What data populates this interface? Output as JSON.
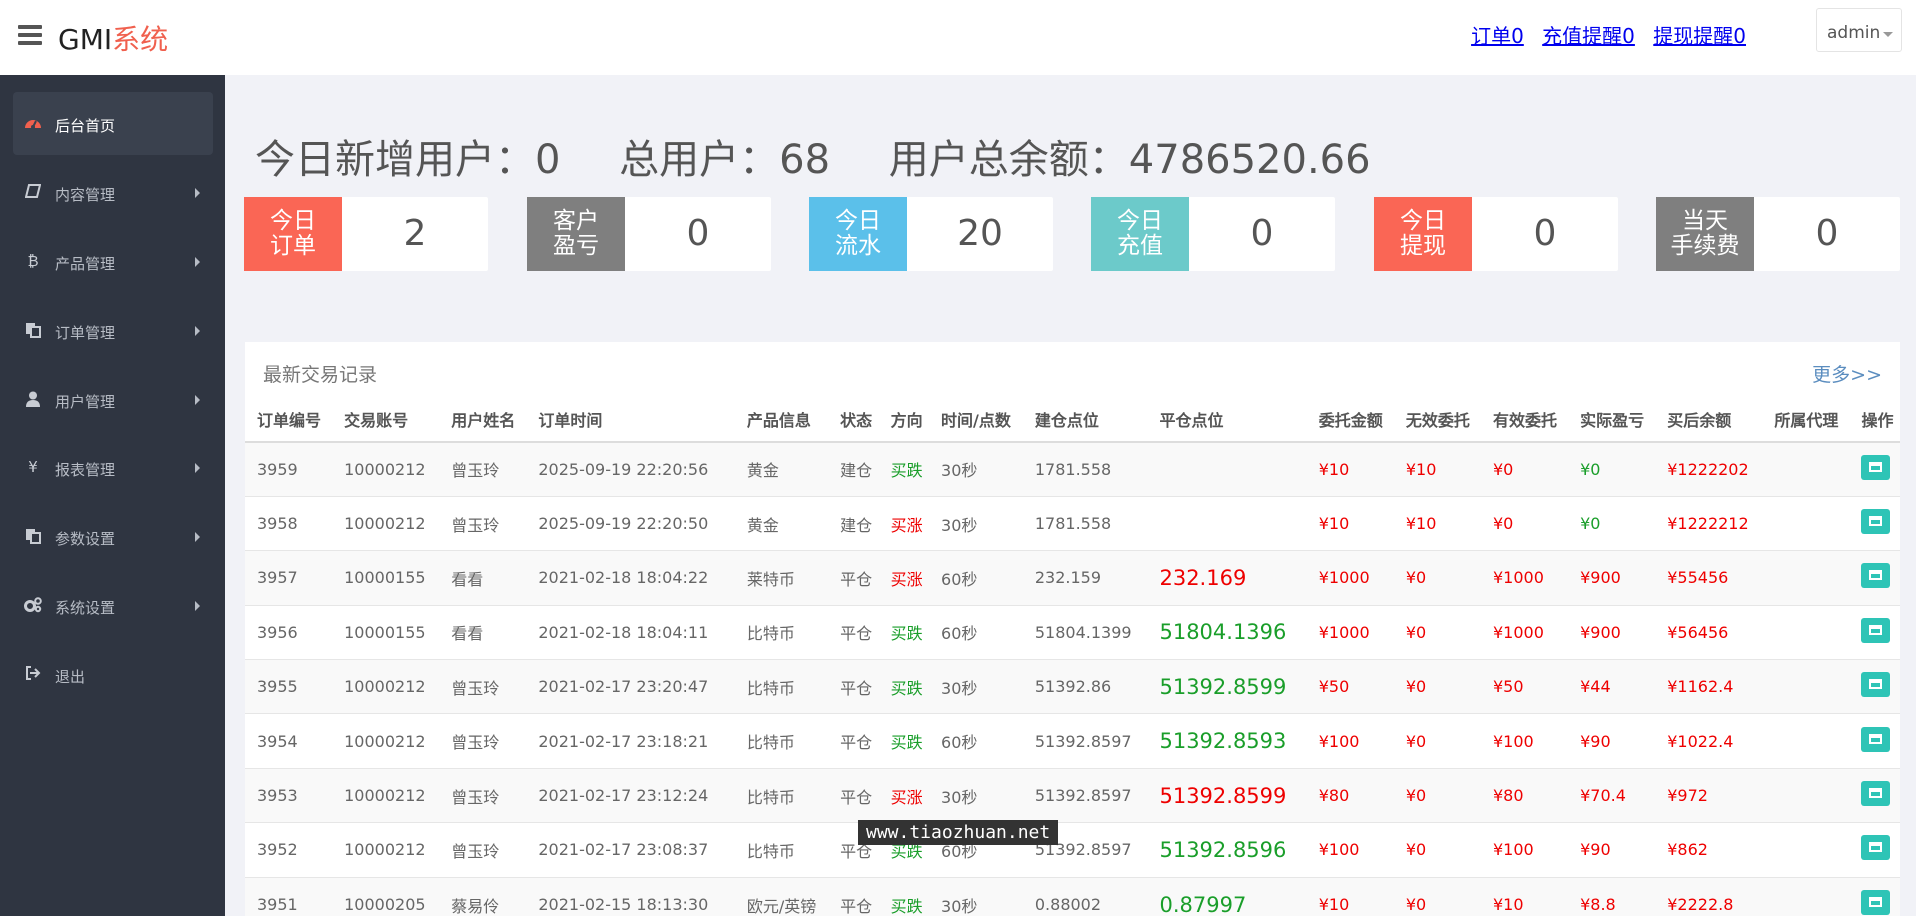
{
  "header": {
    "brand_main": "GMI",
    "brand_accent": "系统",
    "links": [
      "订单0",
      "充值提醒0",
      "提现提醒0"
    ],
    "user": "admin"
  },
  "sidebar": {
    "items": [
      {
        "label": "后台首页",
        "icon": "dashboard-icon",
        "active": true
      },
      {
        "label": "内容管理",
        "icon": "book-icon"
      },
      {
        "label": "产品管理",
        "icon": "bitcoin-icon"
      },
      {
        "label": "订单管理",
        "icon": "copy-icon"
      },
      {
        "label": "用户管理",
        "icon": "user-icon"
      },
      {
        "label": "报表管理",
        "icon": "yen-icon"
      },
      {
        "label": "参数设置",
        "icon": "copy-icon"
      },
      {
        "label": "系统设置",
        "icon": "gears-icon"
      },
      {
        "label": "退出",
        "icon": "sign-out-icon"
      }
    ]
  },
  "summary": {
    "new_users": "今日新增用户：0",
    "total_users": "总用户：68",
    "balance": "用户总余额：4786520.66"
  },
  "cards": [
    {
      "label": "今日订单",
      "line1": "今日",
      "line2": "订单",
      "value": "2",
      "color": "#fa6655"
    },
    {
      "label": "客户盈亏",
      "line1": "客户",
      "line2": "盈亏",
      "value": "0",
      "color": "#7f7f7f"
    },
    {
      "label": "今日流水",
      "line1": "今日",
      "line2": "流水",
      "value": "20",
      "color": "#5bc0ea"
    },
    {
      "label": "今日充值",
      "line1": "今日",
      "line2": "充值",
      "value": "0",
      "color": "#6ccaca"
    },
    {
      "label": "今日提现",
      "line1": "今日",
      "line2": "提现",
      "value": "0",
      "color": "#fa6655"
    },
    {
      "label": "当天手续费",
      "line1": "当天",
      "line2": "手续费",
      "value": "0",
      "color": "#7f7f7f"
    }
  ],
  "panel": {
    "title": "最新交易记录",
    "more": "更多>>",
    "columns": [
      "订单编号",
      "交易账号",
      "用户姓名",
      "订单时间",
      "产品信息",
      "状态",
      "方向",
      "时间/点数",
      "建仓点位",
      "平仓点位",
      "委托金额",
      "无效委托",
      "有效委托",
      "实际盈亏",
      "买后余额",
      "所属代理",
      "操作"
    ],
    "rows": [
      {
        "id": "3959",
        "account": "10000212",
        "name": "曾玉玲",
        "time": "2025-09-19 22:20:56",
        "product": "黄金",
        "status": "建仓",
        "dir": "买跌",
        "dir_color": "green",
        "period": "30秒",
        "open": "1781.558",
        "close": "",
        "close_color": "",
        "amount": "¥10",
        "invalid": "¥10",
        "valid": "¥0",
        "pnl": "¥0",
        "pnl_color": "green",
        "after": "¥1222202",
        "agent": ""
      },
      {
        "id": "3958",
        "account": "10000212",
        "name": "曾玉玲",
        "time": "2025-09-19 22:20:50",
        "product": "黄金",
        "status": "建仓",
        "dir": "买涨",
        "dir_color": "red",
        "period": "30秒",
        "open": "1781.558",
        "close": "",
        "close_color": "",
        "amount": "¥10",
        "invalid": "¥10",
        "valid": "¥0",
        "pnl": "¥0",
        "pnl_color": "green",
        "after": "¥1222212",
        "agent": ""
      },
      {
        "id": "3957",
        "account": "10000155",
        "name": "看看",
        "time": "2021-02-18 18:04:22",
        "product": "莱特币",
        "status": "平仓",
        "dir": "买涨",
        "dir_color": "red",
        "period": "60秒",
        "open": "232.159",
        "close": "232.169",
        "close_color": "red",
        "amount": "¥1000",
        "invalid": "¥0",
        "valid": "¥1000",
        "pnl": "¥900",
        "pnl_color": "red",
        "after": "¥55456",
        "agent": ""
      },
      {
        "id": "3956",
        "account": "10000155",
        "name": "看看",
        "time": "2021-02-18 18:04:11",
        "product": "比特币",
        "status": "平仓",
        "dir": "买跌",
        "dir_color": "green",
        "period": "60秒",
        "open": "51804.1399",
        "close": "51804.1396",
        "close_color": "green",
        "amount": "¥1000",
        "invalid": "¥0",
        "valid": "¥1000",
        "pnl": "¥900",
        "pnl_color": "red",
        "after": "¥56456",
        "agent": ""
      },
      {
        "id": "3955",
        "account": "10000212",
        "name": "曾玉玲",
        "time": "2021-02-17 23:20:47",
        "product": "比特币",
        "status": "平仓",
        "dir": "买跌",
        "dir_color": "green",
        "period": "30秒",
        "open": "51392.86",
        "close": "51392.8599",
        "close_color": "green",
        "amount": "¥50",
        "invalid": "¥0",
        "valid": "¥50",
        "pnl": "¥44",
        "pnl_color": "red",
        "after": "¥1162.4",
        "agent": ""
      },
      {
        "id": "3954",
        "account": "10000212",
        "name": "曾玉玲",
        "time": "2021-02-17 23:18:21",
        "product": "比特币",
        "status": "平仓",
        "dir": "买跌",
        "dir_color": "green",
        "period": "60秒",
        "open": "51392.8597",
        "close": "51392.8593",
        "close_color": "green",
        "amount": "¥100",
        "invalid": "¥0",
        "valid": "¥100",
        "pnl": "¥90",
        "pnl_color": "red",
        "after": "¥1022.4",
        "agent": ""
      },
      {
        "id": "3953",
        "account": "10000212",
        "name": "曾玉玲",
        "time": "2021-02-17 23:12:24",
        "product": "比特币",
        "status": "平仓",
        "dir": "买涨",
        "dir_color": "red",
        "period": "30秒",
        "open": "51392.8597",
        "close": "51392.8599",
        "close_color": "red",
        "amount": "¥80",
        "invalid": "¥0",
        "valid": "¥80",
        "pnl": "¥70.4",
        "pnl_color": "red",
        "after": "¥972",
        "agent": ""
      },
      {
        "id": "3952",
        "account": "10000212",
        "name": "曾玉玲",
        "time": "2021-02-17 23:08:37",
        "product": "比特币",
        "status": "平仓",
        "dir": "买跌",
        "dir_color": "green",
        "period": "60秒",
        "open": "51392.8597",
        "close": "51392.8596",
        "close_color": "green",
        "amount": "¥100",
        "invalid": "¥0",
        "valid": "¥100",
        "pnl": "¥90",
        "pnl_color": "red",
        "after": "¥862",
        "agent": ""
      },
      {
        "id": "3951",
        "account": "10000205",
        "name": "蔡易伶",
        "time": "2021-02-15 18:13:30",
        "product": "欧元/英镑",
        "status": "平仓",
        "dir": "买跌",
        "dir_color": "green",
        "period": "30秒",
        "open": "0.88002",
        "close": "0.87997",
        "close_color": "green",
        "amount": "¥10",
        "invalid": "¥0",
        "valid": "¥10",
        "pnl": "¥8.8",
        "pnl_color": "red",
        "after": "¥2222.8",
        "agent": ""
      }
    ]
  },
  "watermark": "www.tiaozhuan.net"
}
